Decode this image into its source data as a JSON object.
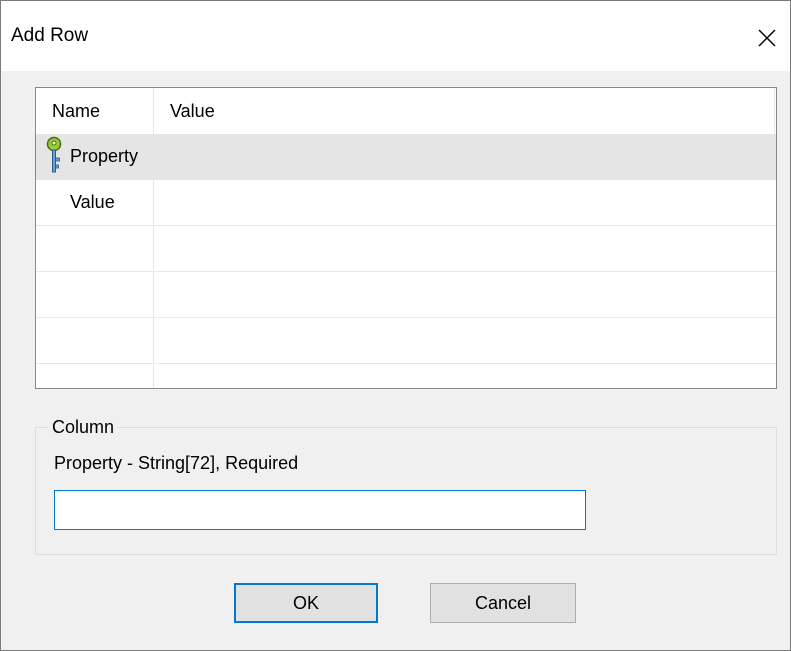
{
  "window": {
    "title": "Add Row",
    "close_icon": "close-icon"
  },
  "grid": {
    "columns": [
      "Name",
      "Value"
    ],
    "rows": [
      {
        "name": "Property",
        "value": "",
        "icon": "key-icon",
        "selected": true
      },
      {
        "name": "Value",
        "value": "",
        "selected": false
      },
      {
        "name": "",
        "value": ""
      },
      {
        "name": "",
        "value": ""
      },
      {
        "name": "",
        "value": ""
      }
    ]
  },
  "column_group": {
    "legend": "Column",
    "description": "Property - String[72], Required",
    "input_value": ""
  },
  "buttons": {
    "ok": "OK",
    "cancel": "Cancel"
  },
  "colors": {
    "focus_accent": "#0078d7",
    "selected_row": "#e5e5e5",
    "dialog_bg": "#f0f0f0"
  }
}
